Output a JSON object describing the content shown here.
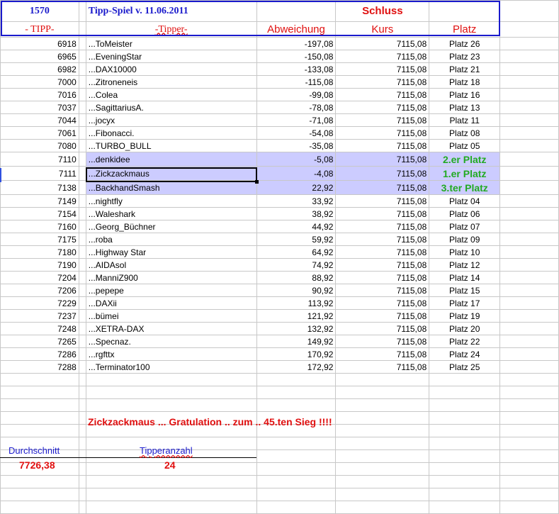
{
  "header": {
    "tipp_count": "1570",
    "title": "Tipp-Spiel v. 11.06.2011",
    "schluss": "Schluss",
    "col_tipp": "- TIPP-",
    "col_tipper": "-Tipper-",
    "col_abweichung": "Abweichung",
    "col_kurs": "Kurs",
    "col_platz": "Platz"
  },
  "rows": [
    {
      "tipp": "6918",
      "tipper": "...ToMeister",
      "abw": "-197,08",
      "kurs": "7115,08",
      "platz": "Platz 26"
    },
    {
      "tipp": "6965",
      "tipper": "...EveningStar",
      "abw": "-150,08",
      "kurs": "7115,08",
      "platz": "Platz 23"
    },
    {
      "tipp": "6982",
      "tipper": "...DAX10000",
      "abw": "-133,08",
      "kurs": "7115,08",
      "platz": "Platz 21"
    },
    {
      "tipp": "7000",
      "tipper": "...Zitroneneis",
      "abw": "-115,08",
      "kurs": "7115,08",
      "platz": "Platz 18"
    },
    {
      "tipp": "7016",
      "tipper": "...Colea",
      "abw": "-99,08",
      "kurs": "7115,08",
      "platz": "Platz 16"
    },
    {
      "tipp": "7037",
      "tipper": "...SagittariusA.",
      "abw": "-78,08",
      "kurs": "7115,08",
      "platz": "Platz 13"
    },
    {
      "tipp": "7044",
      "tipper": "...jocyx",
      "abw": "-71,08",
      "kurs": "7115,08",
      "platz": "Platz 11"
    },
    {
      "tipp": "7061",
      "tipper": "...Fibonacci.",
      "abw": "-54,08",
      "kurs": "7115,08",
      "platz": "Platz 08"
    },
    {
      "tipp": "7080",
      "tipper": "...TURBO_BULL",
      "abw": "-35,08",
      "kurs": "7115,08",
      "platz": "Platz 05"
    },
    {
      "tipp": "7110",
      "tipper": "...denkidee",
      "abw": "-5,08",
      "kurs": "7115,08",
      "platz": "2.er Platz",
      "winner": true
    },
    {
      "tipp": "7111",
      "tipper": "...Zickzackmaus",
      "abw": "-4,08",
      "kurs": "7115,08",
      "platz": "1.er Platz",
      "winner": true
    },
    {
      "tipp": "7138",
      "tipper": "...BackhandSmash",
      "abw": "22,92",
      "kurs": "7115,08",
      "platz": "3.ter Platz",
      "winner": true
    },
    {
      "tipp": "7149",
      "tipper": "...nightfly",
      "abw": "33,92",
      "kurs": "7115,08",
      "platz": "Platz 04"
    },
    {
      "tipp": "7154",
      "tipper": "...Waleshark",
      "abw": "38,92",
      "kurs": "7115,08",
      "platz": "Platz 06"
    },
    {
      "tipp": "7160",
      "tipper": "...Georg_Büchner",
      "abw": "44,92",
      "kurs": "7115,08",
      "platz": "Platz 07"
    },
    {
      "tipp": "7175",
      "tipper": "...roba",
      "abw": "59,92",
      "kurs": "7115,08",
      "platz": "Platz 09"
    },
    {
      "tipp": "7180",
      "tipper": "...Highway Star",
      "abw": "64,92",
      "kurs": "7115,08",
      "platz": "Platz 10"
    },
    {
      "tipp": "7190",
      "tipper": "...AIDAsol",
      "abw": "74,92",
      "kurs": "7115,08",
      "platz": "Platz 12"
    },
    {
      "tipp": "7204",
      "tipper": "...ManniZ900",
      "abw": "88,92",
      "kurs": "7115,08",
      "platz": "Platz 14"
    },
    {
      "tipp": "7206",
      "tipper": "...pepepe",
      "abw": "90,92",
      "kurs": "7115,08",
      "platz": "Platz 15"
    },
    {
      "tipp": "7229",
      "tipper": "...DAXii",
      "abw": "113,92",
      "kurs": "7115,08",
      "platz": "Platz 17"
    },
    {
      "tipp": "7237",
      "tipper": "...bümei",
      "abw": "121,92",
      "kurs": "7115,08",
      "platz": "Platz 19"
    },
    {
      "tipp": "7248",
      "tipper": "...XETRA-DAX",
      "abw": "132,92",
      "kurs": "7115,08",
      "platz": "Platz 20"
    },
    {
      "tipp": "7265",
      "tipper": "...Specnaz.",
      "abw": "149,92",
      "kurs": "7115,08",
      "platz": "Platz 22"
    },
    {
      "tipp": "7286",
      "tipper": "...rgfttx",
      "abw": "170,92",
      "kurs": "7115,08",
      "platz": "Platz 24"
    },
    {
      "tipp": "7288",
      "tipper": "...Terminator100",
      "abw": "172,92",
      "kurs": "7115,08",
      "platz": "Platz 25"
    }
  ],
  "footer": {
    "message": "Zickzackmaus  ... Gratulation .. zum .. 45.ten Sieg !!!!",
    "avg_label": "Durchschnitt",
    "avg_value": "7726,38",
    "count_label": "Tipperanzahl",
    "count_value": "24"
  }
}
